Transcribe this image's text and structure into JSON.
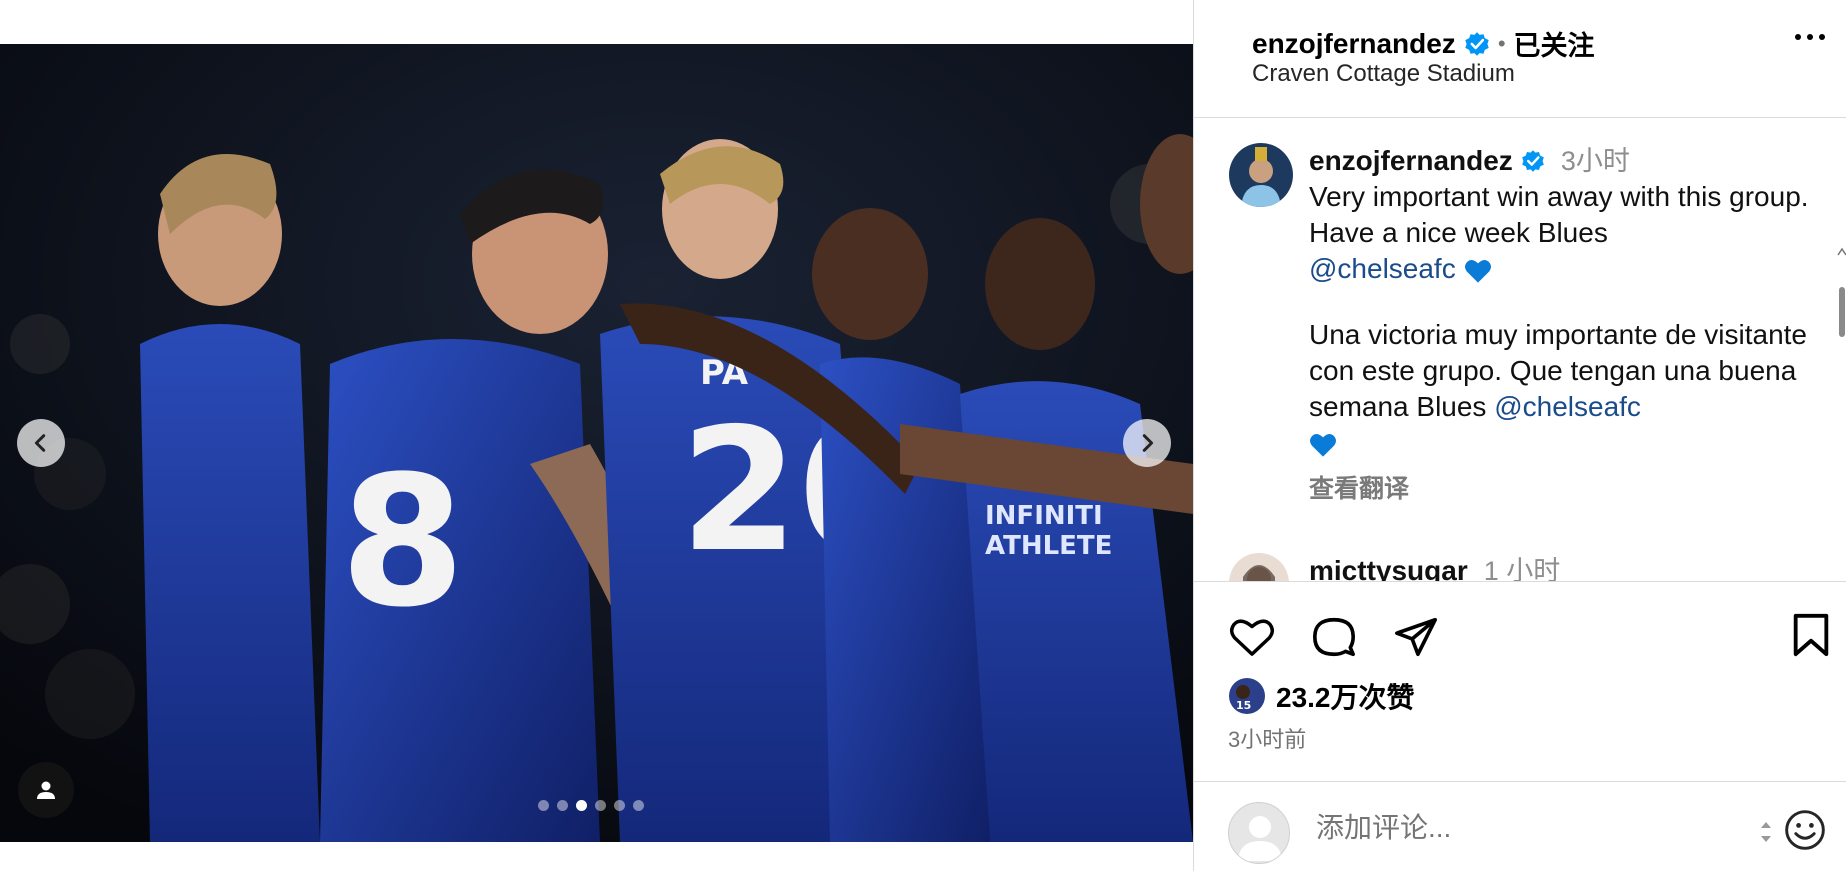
{
  "post": {
    "username": "enzojfernandez",
    "follow_status": "已关注",
    "location": "Craven Cottage Stadium",
    "separator": "•"
  },
  "media": {
    "image_description_icon": "photo",
    "dots_count": 6,
    "active_dot_index": 2,
    "jersey_numbers": [
      "8",
      "20"
    ],
    "jersey_name": "PA",
    "sponsor_text": "INFINITI ATHLETE"
  },
  "caption": {
    "username": "enzojfernandez",
    "time": "3小时",
    "line1": "Very important win away with this group. Have a nice week Blues",
    "mention1": "@chelseafc",
    "line2": "Una victoria muy importante de visitante con este grupo. Que tengan una buena semana Blues",
    "mention2": "@chelseafc",
    "translate_label": "查看翻译"
  },
  "next_comment": {
    "username": "micttysugar",
    "time": "1 小时"
  },
  "actions": {
    "likes": "23.2万次赞",
    "posted_time": "3小时前"
  },
  "comment_input": {
    "placeholder": "添加评论..."
  },
  "colors": {
    "verified": "#0095f6",
    "mention": "#1a4c8b",
    "heart": "#0a7bd6",
    "border": "#dbdbdb"
  }
}
